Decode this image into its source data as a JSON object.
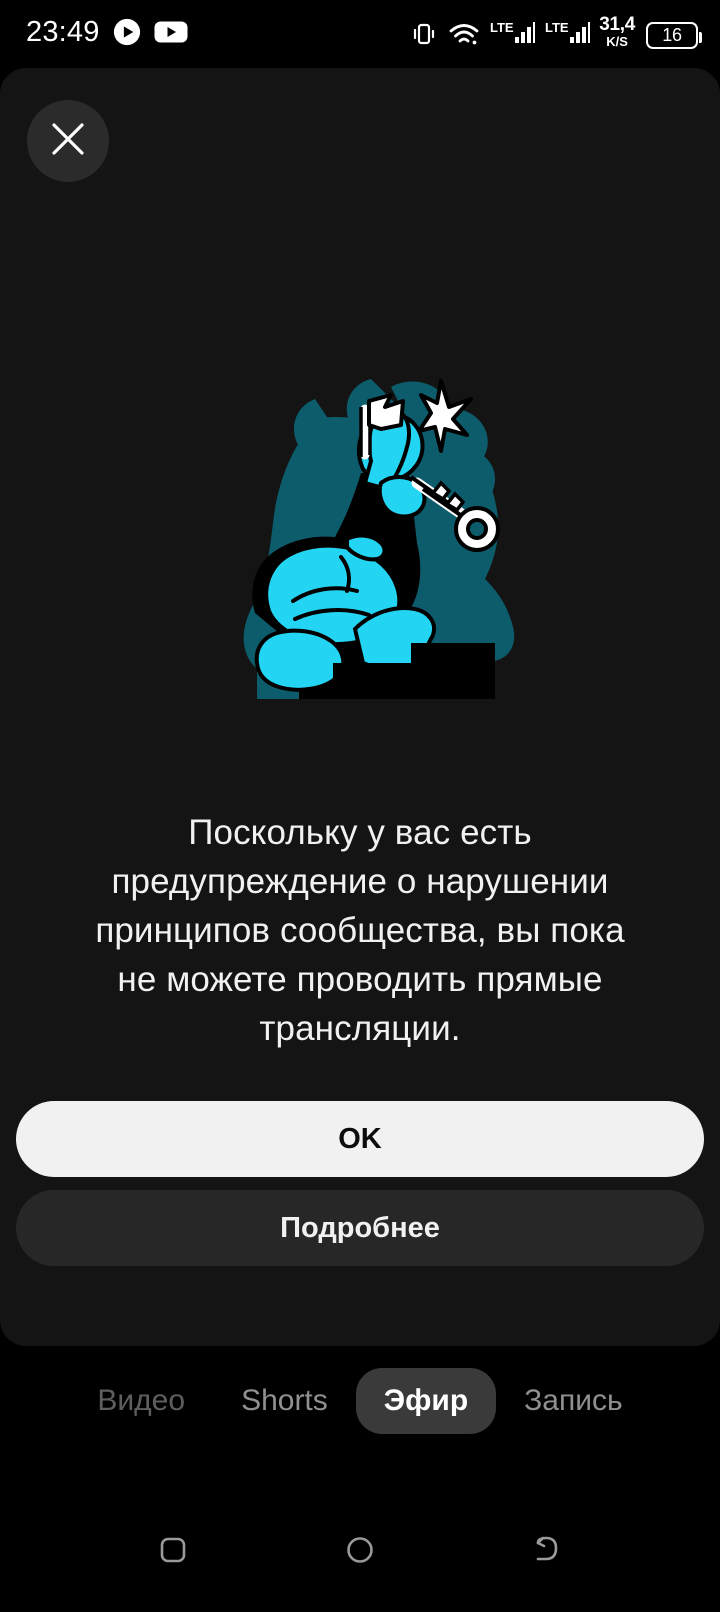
{
  "status_bar": {
    "clock": "23:49",
    "left_icons": [
      "play-circle-icon",
      "youtube-icon"
    ],
    "right_icons": [
      "vibrate-icon",
      "wifi-icon",
      "lte-signal-1-icon",
      "lte-signal-2-icon"
    ],
    "lte_label_1": "LTE",
    "lte_label_2": "LTE",
    "net_speed_value": "31,4",
    "net_speed_unit": "K/S",
    "battery_level": "16"
  },
  "sheet": {
    "close_label": "close-icon",
    "illustration_name": "thinking-person-with-key-illustration",
    "message": "Поскольку у вас есть предупреждение о нарушении принципов сообщества, вы пока не можете проводить прямые трансляции.",
    "primary_button": "OK",
    "secondary_button": "Подробнее"
  },
  "mode_tabs": [
    {
      "label": "Видео",
      "state": "dim"
    },
    {
      "label": "Shorts",
      "state": "inactive"
    },
    {
      "label": "Эфир",
      "state": "active"
    },
    {
      "label": "Запись",
      "state": "inactive"
    }
  ],
  "nav_bar": {
    "recents_label": "recents-icon",
    "home_label": "home-icon",
    "back_label": "back-icon"
  },
  "colors": {
    "background": "#000000",
    "sheet": "#141414",
    "accent_cyan": "#23D5F2",
    "accent_teal": "#0C5C6C",
    "primary_button": "#f1f1f1",
    "secondary_button": "#272727",
    "active_tab": "#3a3a3a",
    "text_primary": "#f1f1f1"
  }
}
